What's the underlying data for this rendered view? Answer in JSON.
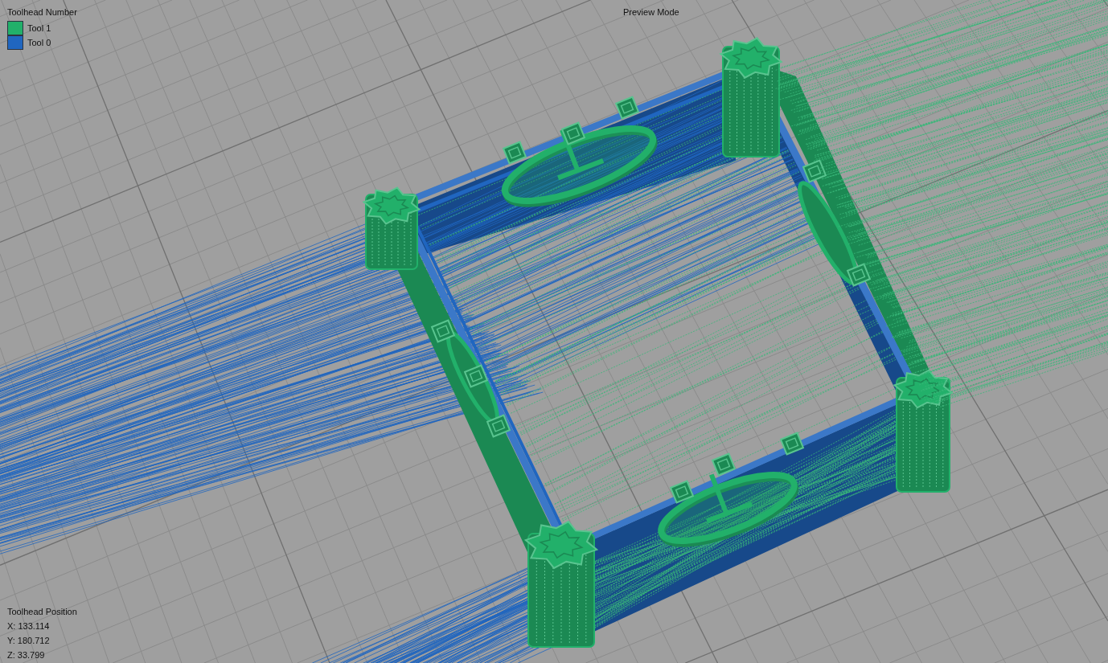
{
  "legend": {
    "title": "Toolhead Number",
    "items": [
      {
        "label": "Tool 1",
        "color": "#22b06a"
      },
      {
        "label": "Tool 0",
        "color": "#2066c0"
      }
    ]
  },
  "view_mode": "Preview Mode",
  "toolhead_position": {
    "title": "Toolhead Position",
    "readouts": [
      "X: 133.114",
      "Y: 180.712",
      "Z: 33.799"
    ]
  }
}
